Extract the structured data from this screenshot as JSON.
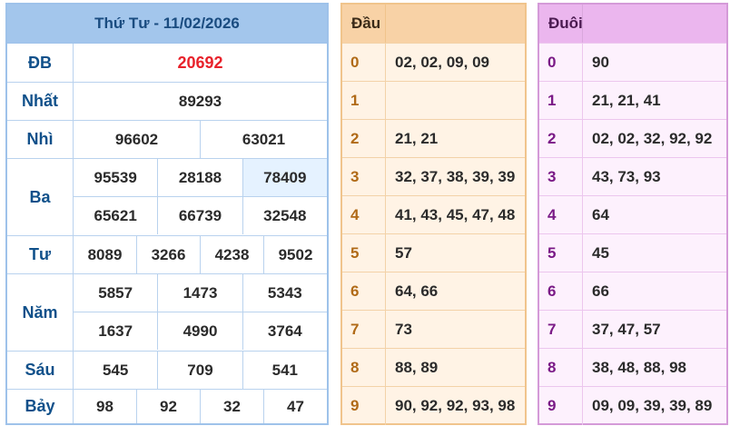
{
  "results": {
    "title": "Thứ Tư - 11/02/2026",
    "prizes": [
      {
        "label": "ĐB",
        "lines": [
          [
            "20692"
          ]
        ]
      },
      {
        "label": "Nhất",
        "lines": [
          [
            "89293"
          ]
        ]
      },
      {
        "label": "Nhì",
        "lines": [
          [
            "96602",
            "63021"
          ]
        ]
      },
      {
        "label": "Ba",
        "lines": [
          [
            "95539",
            "28188",
            "78409"
          ],
          [
            "65621",
            "66739",
            "32548"
          ]
        ]
      },
      {
        "label": "Tư",
        "lines": [
          [
            "8089",
            "3266",
            "4238",
            "9502"
          ]
        ]
      },
      {
        "label": "Năm",
        "lines": [
          [
            "5857",
            "1473",
            "5343"
          ],
          [
            "1637",
            "4990",
            "3764"
          ]
        ]
      },
      {
        "label": "Sáu",
        "lines": [
          [
            "545",
            "709",
            "541"
          ]
        ]
      },
      {
        "label": "Bảy",
        "lines": [
          [
            "98",
            "92",
            "32",
            "47"
          ]
        ]
      }
    ]
  },
  "dau": {
    "header": "Đầu",
    "rows": [
      {
        "key": "0",
        "value": "02, 02, 09, 09"
      },
      {
        "key": "1",
        "value": ""
      },
      {
        "key": "2",
        "value": "21, 21"
      },
      {
        "key": "3",
        "value": "32, 37, 38, 39, 39"
      },
      {
        "key": "4",
        "value": "41, 43, 45, 47, 48"
      },
      {
        "key": "5",
        "value": "57"
      },
      {
        "key": "6",
        "value": "64, 66"
      },
      {
        "key": "7",
        "value": "73"
      },
      {
        "key": "8",
        "value": "88, 89"
      },
      {
        "key": "9",
        "value": "90, 92, 92, 93, 98"
      }
    ]
  },
  "duoi": {
    "header": "Đuôi",
    "rows": [
      {
        "key": "0",
        "value": "90"
      },
      {
        "key": "1",
        "value": "21, 21, 41"
      },
      {
        "key": "2",
        "value": "02, 02, 32, 92, 92"
      },
      {
        "key": "3",
        "value": "43, 73, 93"
      },
      {
        "key": "4",
        "value": "64"
      },
      {
        "key": "5",
        "value": "45"
      },
      {
        "key": "6",
        "value": "66"
      },
      {
        "key": "7",
        "value": "37, 47, 57"
      },
      {
        "key": "8",
        "value": "38, 48, 88, 98"
      },
      {
        "key": "9",
        "value": "09, 09, 39, 39, 89"
      }
    ]
  },
  "colors": {
    "special_prize": "#e8222b",
    "result_header": "#a3c6ec",
    "dau_header": "#f8d2a6",
    "duoi_header": "#ebb6ee"
  }
}
